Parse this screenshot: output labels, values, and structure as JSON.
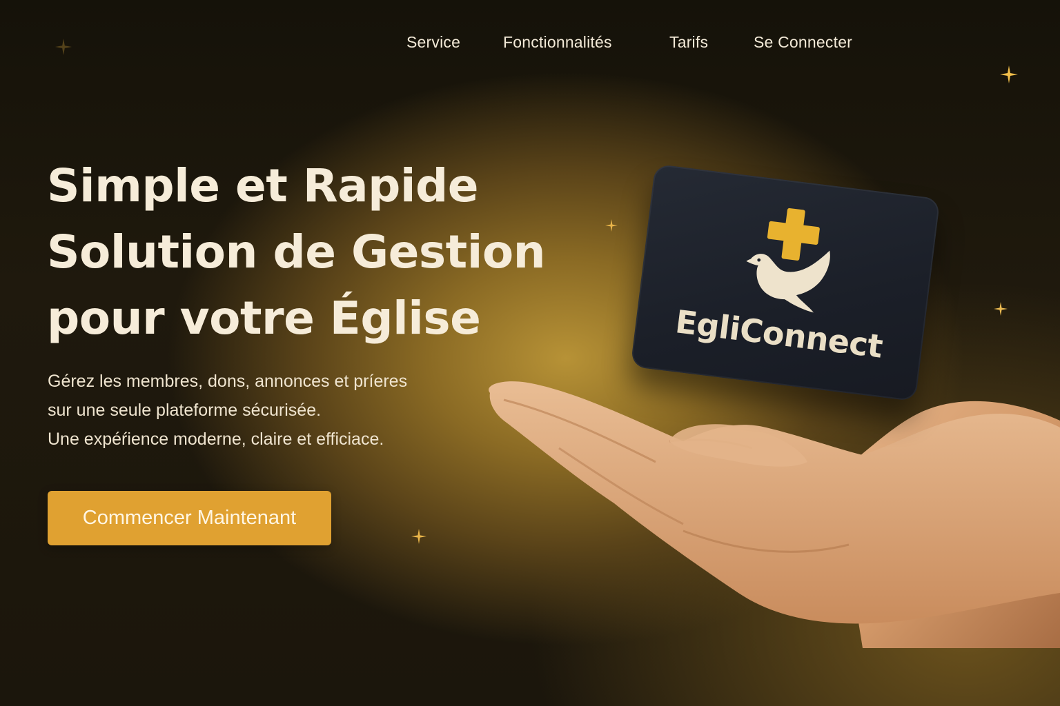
{
  "nav": {
    "items": [
      {
        "label": "Service"
      },
      {
        "label": "Fonctionnalités"
      },
      {
        "label": "Tarifs"
      },
      {
        "label": "Se Connecter"
      }
    ]
  },
  "hero": {
    "title_lines": [
      "Simple et Rapide",
      "Solution de Gestion",
      "pour votre Église"
    ],
    "subtitle_lines": [
      "Gérez les membres, dons, annonces et príeres",
      "sur une seule plateforme sécurisée.",
      "Une expéŕience moderne, claire et efficiace."
    ],
    "cta_label": "Commencer Maintenant"
  },
  "card": {
    "brand": "EgliConnect",
    "icons": [
      "cross-icon",
      "dove-icon"
    ]
  },
  "colors": {
    "accent": "#e0a131",
    "cross": "#e8b22f",
    "card_bg": "#1e222b",
    "text_light": "#f6ecd9"
  }
}
